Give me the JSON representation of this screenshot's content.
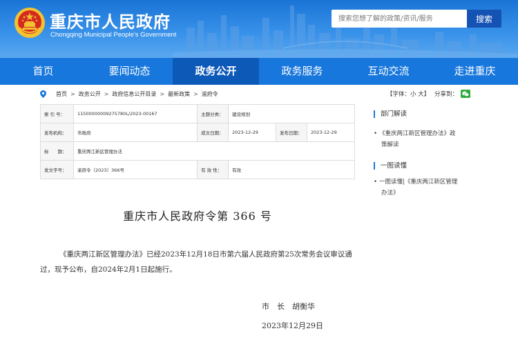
{
  "header": {
    "title": "重庆市人民政府",
    "subtitle": "Chongqing Municipal People's Government",
    "search_placeholder": "搜索您想了解的政策/资讯/服务",
    "search_button": "搜索"
  },
  "nav": {
    "items": [
      "首页",
      "要闻动态",
      "政务公开",
      "政务服务",
      "互动交流",
      "走进重庆"
    ],
    "active": "政务公开"
  },
  "breadcrumb": [
    "首页",
    "政务公开",
    "政府信息公开目录",
    "最新政策",
    "渝府令"
  ],
  "font_size": {
    "label": "【字体：",
    "small": "小",
    "large": "大",
    "close": "】"
  },
  "share": {
    "label": "分享到："
  },
  "meta": {
    "index_label": "索 引 号：",
    "index_value": "11500000009275780L/2023-00167",
    "subject_label": "主题分类：",
    "subject_value": "建设规划",
    "issuer_label": "发布机构：",
    "issuer_value": "市政府",
    "written_label": "成文日期：",
    "written_value": "2023-12-29",
    "published_label": "发布日期：",
    "published_value": "2023-12-29",
    "title_label": "标　　题：",
    "title_value": "重庆两江新区管理办法",
    "docnum_label": "发文字号：",
    "docnum_value": "渝府令〔2023〕366号",
    "validity_label": "有 效 性：",
    "validity_value": "有效"
  },
  "sidebar": {
    "section1": "部门解读",
    "section1_link_line1": "《重庆两江新区管理办法》政",
    "section1_link_line2": "策解读",
    "section2": "一图读懂",
    "section2_link_line1": "一图读懂|《重庆两江新区管理",
    "section2_link_line2": "办法》",
    "bullet": "•"
  },
  "document": {
    "title": "重庆市人民政府令第  366  号",
    "paragraph": "《重庆两江新区管理办法》已经2023年12月18日市第六届人民政府第25次常务会议审议通过，现予公布，自2024年2月1日起施行。",
    "signer": "市　长　胡衡华",
    "date": "2023年12月29日"
  },
  "colors": {
    "header_blue": "#1a74d6",
    "nav_blue": "#1777dc",
    "nav_active": "#0d59b8",
    "search_button": "#1453b3",
    "wechat_green": "#2bab3b",
    "emblem_red": "#d42a20",
    "emblem_gold": "#f2c230"
  },
  "icons": [
    "national-emblem-icon",
    "location-pin-icon",
    "wechat-icon"
  ]
}
